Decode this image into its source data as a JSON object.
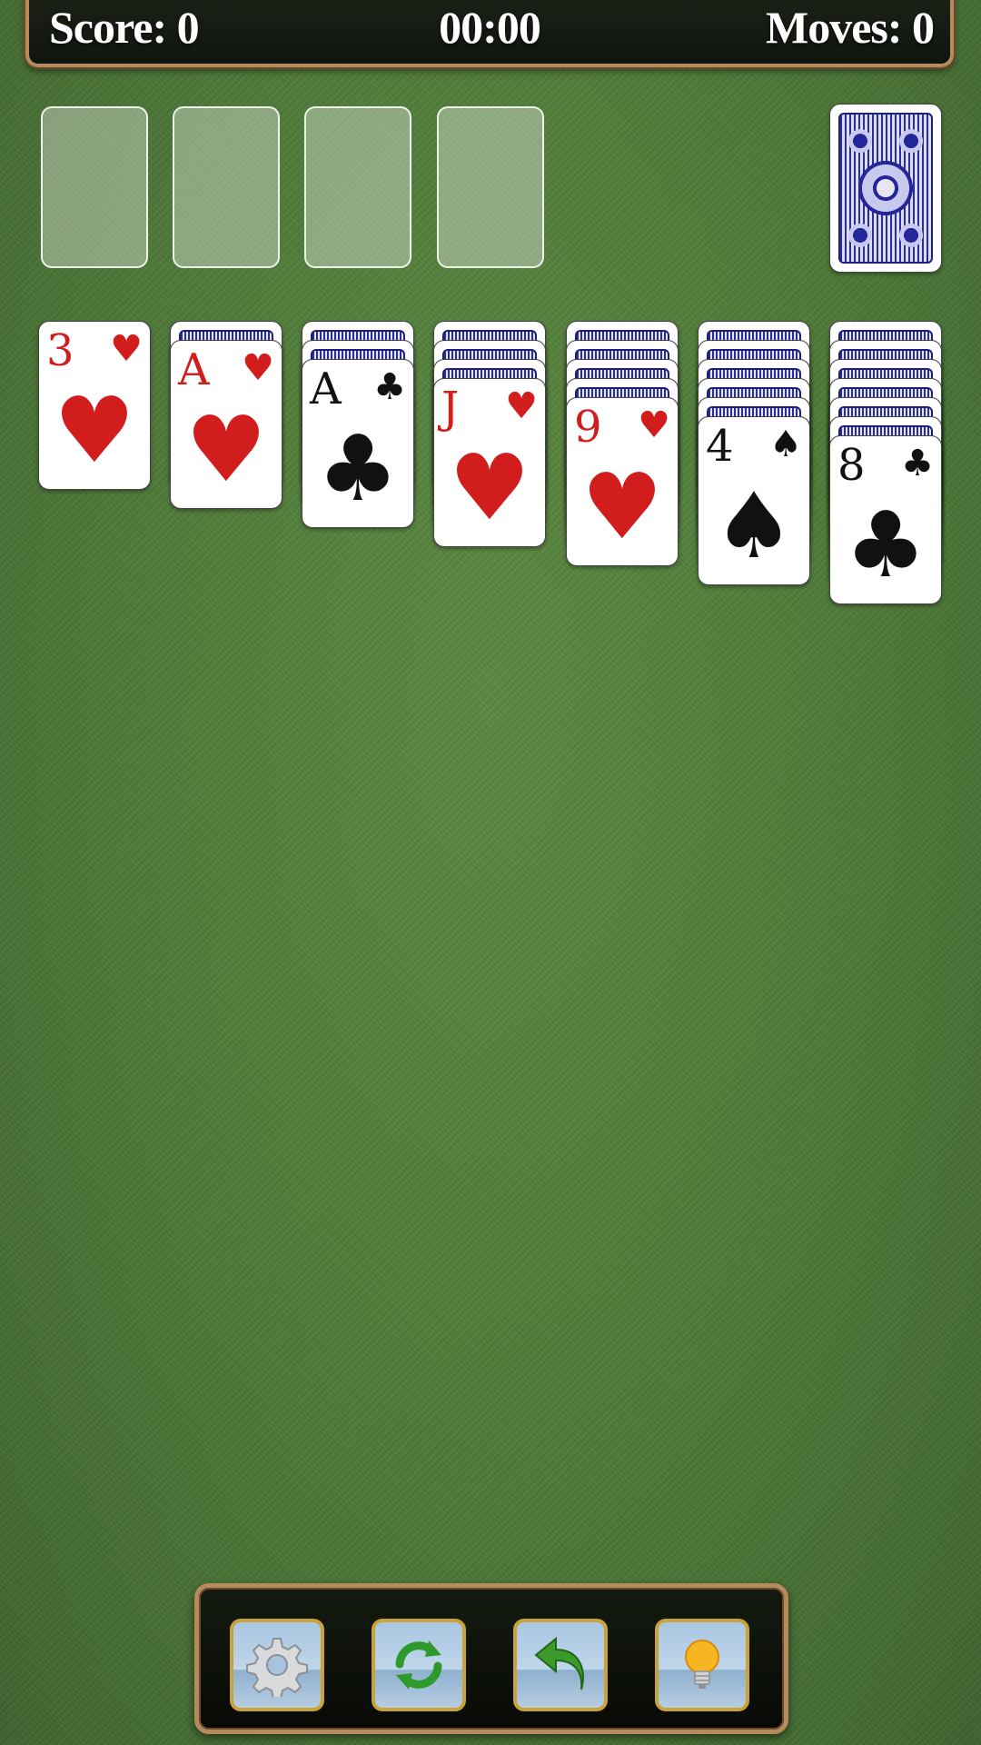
{
  "header": {
    "score_label": "Score: 0",
    "timer": "00:00",
    "moves_label": "Moves: 0"
  },
  "foundations": [
    "empty",
    "empty",
    "empty",
    "empty"
  ],
  "stock": {
    "state": "face-down"
  },
  "tableau": [
    {
      "hidden": 0,
      "top": {
        "rank": "3",
        "suit": "♥",
        "color": "red"
      }
    },
    {
      "hidden": 1,
      "top": {
        "rank": "A",
        "suit": "♥",
        "color": "red"
      }
    },
    {
      "hidden": 2,
      "top": {
        "rank": "A",
        "suit": "♣",
        "color": "black"
      }
    },
    {
      "hidden": 3,
      "top": {
        "rank": "J",
        "suit": "♥",
        "color": "red"
      }
    },
    {
      "hidden": 4,
      "top": {
        "rank": "9",
        "suit": "♥",
        "color": "red"
      }
    },
    {
      "hidden": 5,
      "top": {
        "rank": "4",
        "suit": "♠",
        "color": "black"
      }
    },
    {
      "hidden": 6,
      "top": {
        "rank": "8",
        "suit": "♣",
        "color": "black"
      }
    }
  ],
  "toolbar": {
    "buttons": [
      "gear-icon",
      "refresh-icon",
      "undo-icon",
      "lightbulb-icon"
    ]
  },
  "colors": {
    "felt": "#4f7a39",
    "frame": "#b58a5c",
    "red_suit": "#d21d1d",
    "card_back": "#2a2e9a"
  }
}
